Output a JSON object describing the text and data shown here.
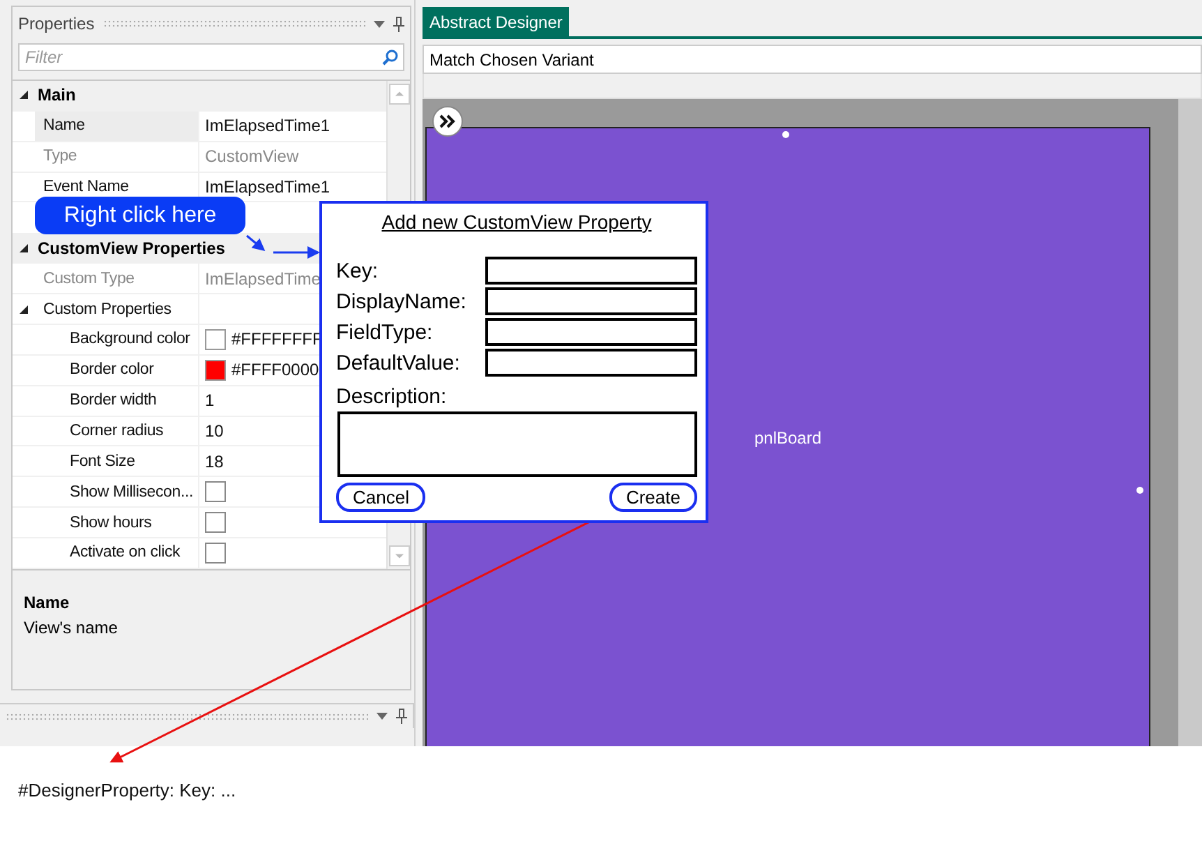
{
  "properties_panel": {
    "title": "Properties",
    "filter": {
      "placeholder": "Filter"
    },
    "rows": [
      {
        "kind": "category",
        "name": "Main",
        "expanded": true,
        "children": [
          {
            "kind": "property",
            "name": "Name",
            "value": "ImElapsedTime1",
            "greyed": false,
            "selected": true
          },
          {
            "kind": "property",
            "name": "Type",
            "value": "CustomView",
            "greyed": true,
            "selected": false
          },
          {
            "kind": "property",
            "name": "Event Name",
            "value": "ImElapsedTime1",
            "greyed": false,
            "selected": false
          }
        ]
      },
      {
        "kind": "category",
        "name": "CustomView Properties",
        "expanded": true,
        "children": [
          {
            "kind": "property",
            "name": "Custom Type",
            "value": "ImElapsedTime",
            "greyed": true,
            "selected": false
          },
          {
            "kind": "group",
            "name": "Custom Properties",
            "expanded": true,
            "children": [
              {
                "kind": "color",
                "name": "Background color",
                "value": "#FFFFFFFF",
                "color": "#ffffff"
              },
              {
                "kind": "color",
                "name": "Border color",
                "value": "#FFFF0000",
                "color": "#ff0000"
              },
              {
                "kind": "property",
                "name": "Border width",
                "value": "1",
                "greyed": false,
                "selected": false
              },
              {
                "kind": "property",
                "name": "Corner radius",
                "value": "10",
                "greyed": false,
                "selected": false
              },
              {
                "kind": "property",
                "name": "Font Size",
                "value": "18",
                "greyed": false,
                "selected": false
              },
              {
                "kind": "checkbox",
                "name": "Show Millisecon...",
                "checked": false
              },
              {
                "kind": "checkbox",
                "name": "Show hours",
                "checked": false
              },
              {
                "kind": "checkbox",
                "name": "Activate on click",
                "checked": false
              }
            ]
          }
        ]
      }
    ],
    "description": {
      "title": "Name",
      "text": "View's name"
    }
  },
  "designer": {
    "tab": {
      "label": "Abstract Designer",
      "selected": true
    },
    "variant": "Match Chosen Variant",
    "board_label": "pnlBoard"
  },
  "callout": "Right click here",
  "dialog": {
    "title": "Add new CustomView Property",
    "fields": [
      {
        "label": "Key:"
      },
      {
        "label": "DisplayName:"
      },
      {
        "label": "FieldType:"
      },
      {
        "label": "DefaultValue:"
      }
    ],
    "description_label": "Description:",
    "buttons": [
      "Cancel",
      "Create"
    ]
  },
  "note": "#DesignerProperty: Key: ..."
}
